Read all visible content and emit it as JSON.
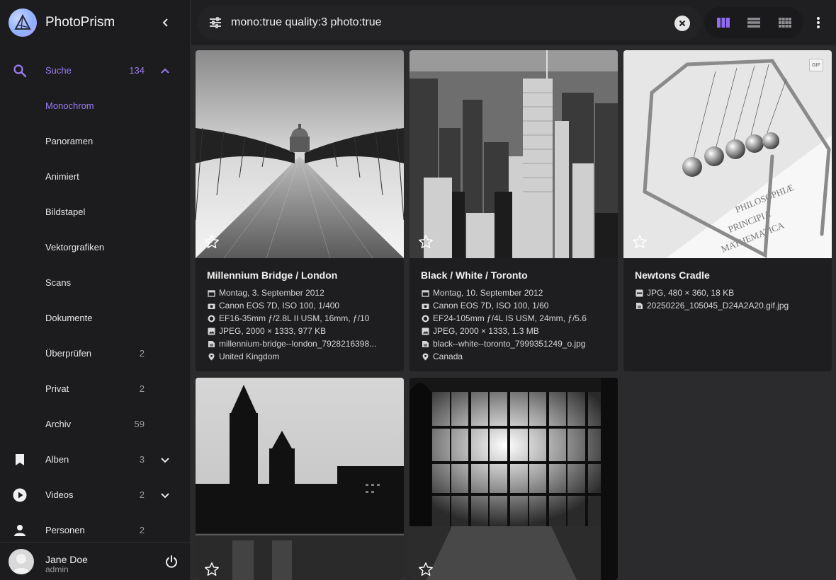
{
  "brand": {
    "title": "PhotoPrism",
    "logo_icon": "prism-logo-icon"
  },
  "sidebar": {
    "items": [
      {
        "label": "Suche",
        "count": "134",
        "icon": "search-icon",
        "state": "active",
        "expand": "chevron-up-icon"
      },
      {
        "label": "Monochrom",
        "count": "",
        "state": "sub-active"
      },
      {
        "label": "Panoramen",
        "count": ""
      },
      {
        "label": "Animiert",
        "count": ""
      },
      {
        "label": "Bildstapel",
        "count": ""
      },
      {
        "label": "Vektorgrafiken",
        "count": ""
      },
      {
        "label": "Scans",
        "count": ""
      },
      {
        "label": "Dokumente",
        "count": ""
      },
      {
        "label": "Überprüfen",
        "count": "2"
      },
      {
        "label": "Privat",
        "count": "2"
      },
      {
        "label": "Archiv",
        "count": "59"
      },
      {
        "label": "Alben",
        "count": "3",
        "icon": "bookmark-icon",
        "expand": "chevron-down-icon"
      },
      {
        "label": "Videos",
        "count": "2",
        "icon": "play-circle-icon",
        "expand": "chevron-down-icon"
      },
      {
        "label": "Personen",
        "count": "2",
        "icon": "person-icon"
      }
    ]
  },
  "user": {
    "name": "Jane Doe",
    "role": "admin"
  },
  "search": {
    "query": "mono:true quality:3 photo:true"
  },
  "colors": {
    "accent": "#9b7cf2",
    "background": "#2b2b2e",
    "card": "#1e1e21",
    "sidebar": "#1c1c1f"
  },
  "cards": [
    {
      "title": "Millennium Bridge / London",
      "meta": [
        {
          "icon": "calendar-icon",
          "text": "Montag, 3. September 2012"
        },
        {
          "icon": "camera-icon",
          "text": "Canon EOS 7D, ISO 100, 1/400"
        },
        {
          "icon": "aperture-icon",
          "text": "EF16-35mm ƒ/2.8L II USM, 16mm, ƒ/10"
        },
        {
          "icon": "image-icon",
          "text": "JPEG, 2000 × 1333, 977 KB"
        },
        {
          "icon": "file-icon",
          "text": "millennium-bridge--london_7928216398..."
        },
        {
          "icon": "location-pin-icon",
          "text": "United Kingdom"
        }
      ]
    },
    {
      "title": "Black / White / Toronto",
      "meta": [
        {
          "icon": "calendar-icon",
          "text": "Montag, 10. September 2012"
        },
        {
          "icon": "camera-icon",
          "text": "Canon EOS 7D, ISO 100, 1/60"
        },
        {
          "icon": "aperture-icon",
          "text": "EF24-105mm ƒ/4L IS USM, 24mm, ƒ/5.6"
        },
        {
          "icon": "image-icon",
          "text": "JPEG, 2000 × 1333, 1.3 MB"
        },
        {
          "icon": "file-icon",
          "text": "black--white--toronto_7999351249_o.jpg"
        },
        {
          "icon": "location-pin-icon",
          "text": "Canada"
        }
      ]
    },
    {
      "title": "Newtons Cradle",
      "badge": "GIF",
      "meta": [
        {
          "icon": "gif-file-icon",
          "text": "JPG, 480 × 360, 18 KB"
        },
        {
          "icon": "file-icon",
          "text": "20250226_105045_D24A2A20.gif.jpg"
        }
      ]
    }
  ]
}
